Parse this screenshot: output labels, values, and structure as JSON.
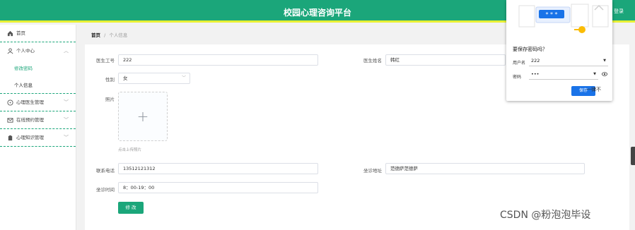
{
  "header": {
    "title": "校园心理咨询平台",
    "login": "登录"
  },
  "sidebar": {
    "items": [
      {
        "label": "首页"
      },
      {
        "label": "个人中心"
      },
      {
        "label": "修改密码"
      },
      {
        "label": "个人信息"
      },
      {
        "label": "心理医生管理"
      },
      {
        "label": "在线预约管理"
      },
      {
        "label": "心理知识管理"
      }
    ]
  },
  "breadcrumb": {
    "home": "首页",
    "sep": "/",
    "current": "个人信息"
  },
  "form": {
    "doctor_id_label": "医生工号",
    "doctor_id": "222",
    "doctor_name_label": "医生姓名",
    "doctor_name": "韩红",
    "gender_label": "性别",
    "gender": "女",
    "photo_label": "照片",
    "upload_tip": "点击上传照片",
    "phone_label": "联系电话",
    "phone": "13512121312",
    "address_label": "坐诊地址",
    "address": "范德萨范德萨",
    "hours_label": "坐诊时间",
    "hours": "8：00-19：00",
    "edit_button": "修 改"
  },
  "password_popup": {
    "question": "要保存密码吗？",
    "username_label": "用户名",
    "username": "222",
    "password_label": "密码",
    "password": "•••",
    "art_text": "* * *",
    "save": "保存",
    "never": "一律不"
  },
  "colors": {
    "primary": "#1ba67a",
    "accent_line": "#e8f035",
    "chrome_blue": "#1a73e8"
  },
  "watermark": "CSDN @粉泡泡毕设"
}
